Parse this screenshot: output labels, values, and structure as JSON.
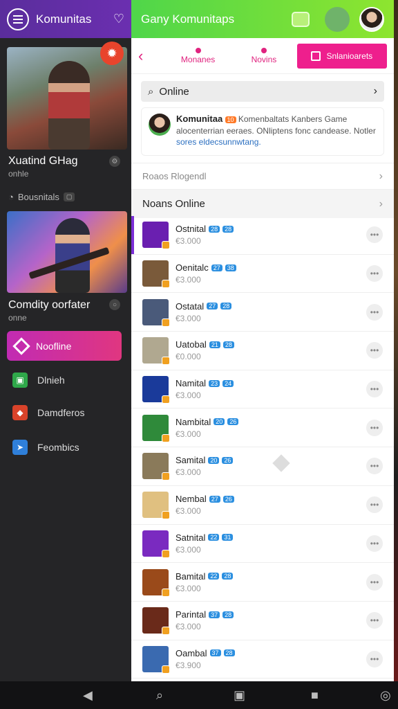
{
  "left_drawer": {
    "title": "Komunitas",
    "cards": [
      {
        "title": "Xuatind GHag",
        "sub": "onhle"
      },
      {
        "title": "Comdity oorfater",
        "sub": "onne"
      }
    ],
    "section_label": "Bousnitals",
    "nav": [
      {
        "label": "Noofline",
        "active": true
      },
      {
        "label": "Dlnieh",
        "color": "#2fa84a"
      },
      {
        "label": "Damdferos",
        "color": "#d9432a"
      },
      {
        "label": "Feombics",
        "color": "#2f7fd9"
      }
    ]
  },
  "main": {
    "title": "Gany Komunitaps",
    "tabs": [
      "Monanes",
      "Novins"
    ],
    "cta": "Snlanioarets",
    "search_label": "Online",
    "info": {
      "name": "Komunitaa",
      "badge": "10",
      "text": "Komenbaltats Kanbers Game alocenterrian eeraes. ONliptens fonc candease. Notler",
      "link": "sores eldecsunnwtang."
    },
    "section_muted": "Roaos Rlogendl",
    "section_header": "Noans Online",
    "items": [
      {
        "name": "Ostnital",
        "b1": "28",
        "b2": "28",
        "price": "€3.000",
        "color": "#6a1fb0",
        "sel": true
      },
      {
        "name": "Oenitalc",
        "b1": "27",
        "b2": "38",
        "price": "€3.000",
        "color": "#7a5a3a"
      },
      {
        "name": "Ostatal",
        "b1": "27",
        "b2": "28",
        "price": "€3.000",
        "color": "#4a5a7a"
      },
      {
        "name": "Uatobal",
        "b1": "21",
        "b2": "28",
        "price": "€0.000",
        "color": "#b0a890"
      },
      {
        "name": "Namital",
        "b1": "23",
        "b2": "24",
        "price": "€3.000",
        "color": "#1a3a9a"
      },
      {
        "name": "Nambital",
        "b1": "20",
        "b2": "26",
        "price": "€3.000",
        "color": "#2f8a3a"
      },
      {
        "name": "Samital",
        "b1": "20",
        "b2": "26",
        "price": "€3.000",
        "color": "#8a7a5a"
      },
      {
        "name": "Nembal",
        "b1": "27",
        "b2": "26",
        "price": "€3.000",
        "color": "#e0c080"
      },
      {
        "name": "Satnital",
        "b1": "22",
        "b2": "31",
        "price": "€3.000",
        "color": "#7a2ac0"
      },
      {
        "name": "Bamital",
        "b1": "22",
        "b2": "28",
        "price": "€3.000",
        "color": "#9a4a1a"
      },
      {
        "name": "Parintal",
        "b1": "37",
        "b2": "28",
        "price": "€3.000",
        "color": "#6a2a1a"
      },
      {
        "name": "Oambal",
        "b1": "37",
        "b2": "28",
        "price": "€3.900",
        "color": "#3a6ab0"
      }
    ]
  }
}
